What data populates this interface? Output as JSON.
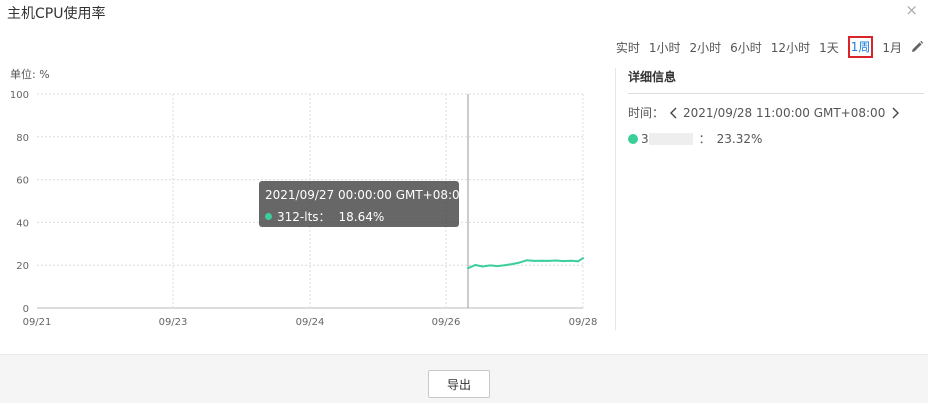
{
  "dialog": {
    "title": "主机CPU使用率",
    "close_glyph": "×"
  },
  "ranges": [
    {
      "label": "实时",
      "active": false
    },
    {
      "label": "1小时",
      "active": false
    },
    {
      "label": "2小时",
      "active": false
    },
    {
      "label": "6小时",
      "active": false
    },
    {
      "label": "12小时",
      "active": false
    },
    {
      "label": "1天",
      "active": false
    },
    {
      "label": "1周",
      "active": true
    },
    {
      "label": "1月",
      "active": false
    }
  ],
  "chart": {
    "unit_label": "单位: %"
  },
  "tooltip": {
    "time": "2021/09/27 00:00:00 GMT+08:00",
    "series": "312-lts：",
    "value": "18.64%"
  },
  "detail": {
    "title": "详细信息",
    "time_label": "时间：",
    "time_value": "2021/09/28 11:00:00 GMT+08:00",
    "series_prefix": "3",
    "series_sep": "：",
    "value": "23.32%"
  },
  "footer": {
    "export_label": "导出"
  },
  "colors": {
    "series": "#3ccf9a",
    "active_range": "#1a7ee0",
    "highlight_border": "#d9252a"
  },
  "chart_data": {
    "type": "line",
    "title": "",
    "ylabel": "单位: %",
    "ylim": [
      0,
      100
    ],
    "yticks": [
      "0",
      "20",
      "40",
      "60",
      "80",
      "100"
    ],
    "xticks": [
      "09/21",
      "09/23",
      "09/24",
      "09/26",
      "09/28"
    ],
    "grid": true,
    "series": [
      {
        "x": [
          "09/27 00:00",
          "09/27 03:00",
          "09/27 06:00",
          "09/27 09:00",
          "09/27 12:00",
          "09/27 15:00",
          "09/27 18:00",
          "09/27 21:00",
          "09/28 00:00",
          "09/28 03:00",
          "09/28 06:00",
          "09/28 09:00",
          "09/28 12:00",
          "09/28 15:00",
          "09/28 18:00",
          "09/28 21:00",
          "09/28 23:00"
        ],
        "values": [
          18.6,
          20.1,
          19.4,
          19.9,
          19.6,
          20.0,
          20.5,
          21.2,
          22.3,
          22.0,
          22.1,
          22.0,
          22.2,
          21.9,
          22.1,
          21.8,
          23.3
        ]
      }
    ]
  }
}
